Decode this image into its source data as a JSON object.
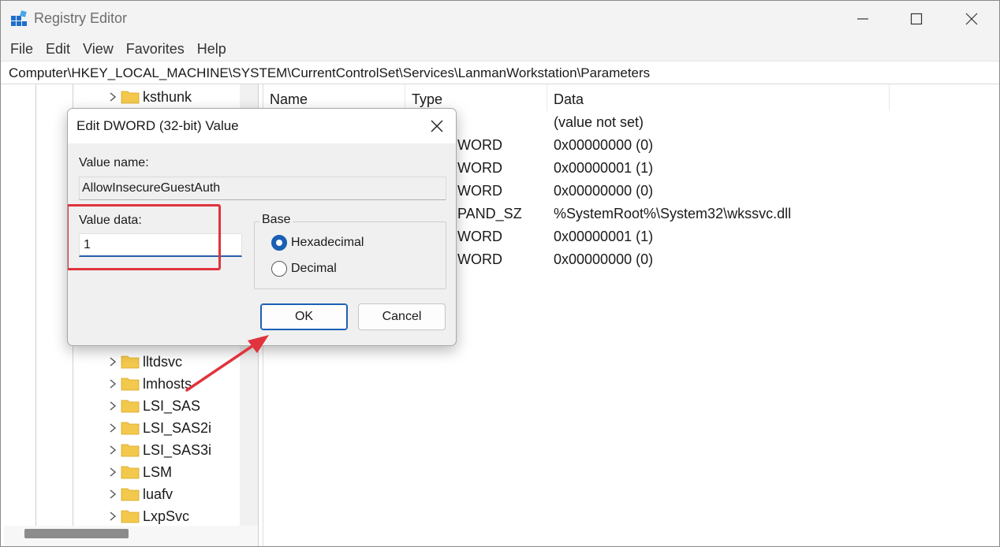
{
  "window": {
    "title": "Registry Editor"
  },
  "menu": [
    "File",
    "Edit",
    "View",
    "Favorites",
    "Help"
  ],
  "address": "Computer\\HKEY_LOCAL_MACHINE\\SYSTEM\\CurrentControlSet\\Services\\LanmanWorkstation\\Parameters",
  "tree": {
    "top_item": "ksthunk",
    "items": [
      "lltdsvc",
      "lmhosts",
      "LSI_SAS",
      "LSI_SAS2i",
      "LSI_SAS3i",
      "LSM",
      "luafv",
      "LxpSvc"
    ]
  },
  "list": {
    "headers": [
      "Name",
      "Type",
      "Data"
    ],
    "rows": [
      {
        "type": "",
        "data": "(value not set)"
      },
      {
        "type": "WORD",
        "data": "0x00000000 (0)"
      },
      {
        "type": "WORD",
        "data": "0x00000001 (1)"
      },
      {
        "type": "WORD",
        "data": "0x00000000 (0)"
      },
      {
        "type": "PAND_SZ",
        "data": "%SystemRoot%\\System32\\wkssvc.dll"
      },
      {
        "type": "WORD",
        "data": "0x00000001 (1)"
      },
      {
        "type": "WORD",
        "data": "0x00000000 (0)"
      }
    ]
  },
  "dialog": {
    "title": "Edit DWORD (32-bit) Value",
    "value_name_label": "Value name:",
    "value_name": "AllowInsecureGuestAuth",
    "value_data_label": "Value data:",
    "value_data": "1",
    "base_label": "Base",
    "radio_hex": "Hexadecimal",
    "radio_dec": "Decimal",
    "base_selected": "Hexadecimal",
    "ok_label": "OK",
    "cancel_label": "Cancel"
  },
  "colors": {
    "highlight": "#e0333d",
    "accent": "#1a5fb4",
    "folder": "#f2c94c"
  },
  "icons": [
    "registry-app-icon",
    "minimize-icon",
    "maximize-icon",
    "close-icon",
    "chevron-right-icon",
    "folder-icon",
    "arrow-annotation"
  ]
}
